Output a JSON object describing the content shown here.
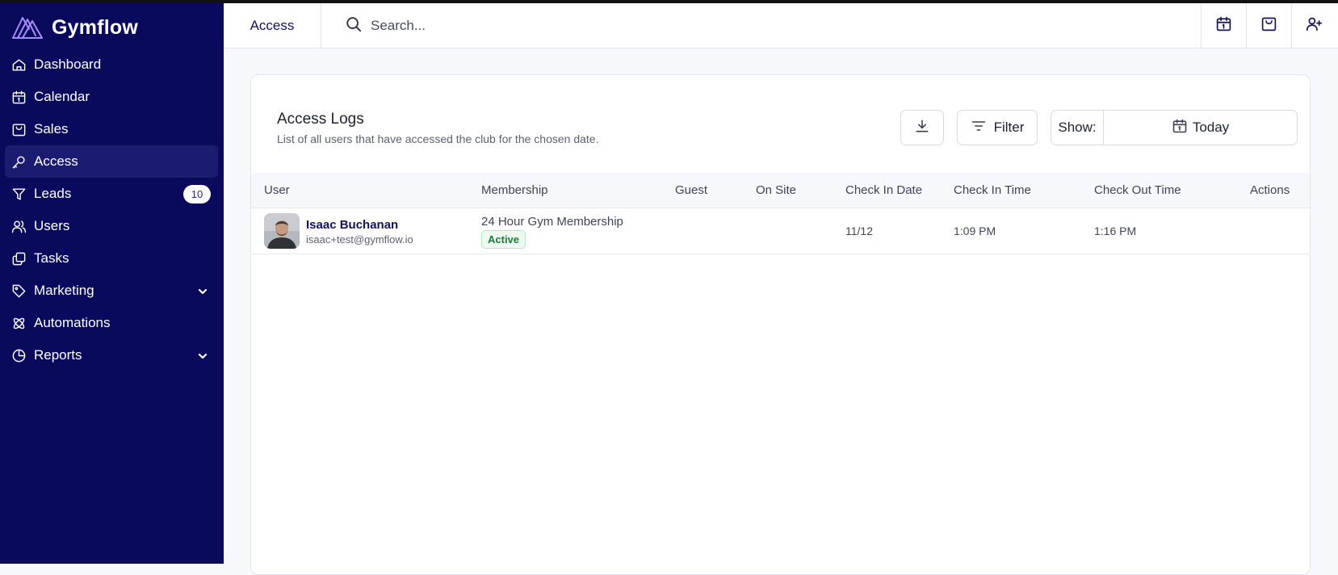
{
  "app": {
    "name": "Gymflow"
  },
  "sidebar": {
    "items": [
      {
        "label": "Dashboard",
        "icon": "home-icon"
      },
      {
        "label": "Calendar",
        "icon": "calendar-icon"
      },
      {
        "label": "Sales",
        "icon": "shopping-bag-icon"
      },
      {
        "label": "Access",
        "icon": "key-icon",
        "active": true
      },
      {
        "label": "Leads",
        "icon": "filter-icon",
        "badge": "10"
      },
      {
        "label": "Users",
        "icon": "users-icon"
      },
      {
        "label": "Tasks",
        "icon": "tasks-icon"
      },
      {
        "label": "Marketing",
        "icon": "tag-icon",
        "expandable": true
      },
      {
        "label": "Automations",
        "icon": "atom-icon"
      },
      {
        "label": "Reports",
        "icon": "pie-chart-icon",
        "expandable": true
      }
    ]
  },
  "header": {
    "title": "Access",
    "search_placeholder": "Search...",
    "actions": [
      "calendar-icon",
      "shopping-bag-icon",
      "user-plus-icon"
    ]
  },
  "card": {
    "title": "Access Logs",
    "subtitle": "List of all users that have accessed the club for the chosen date.",
    "filter_label": "Filter",
    "show_label": "Show:",
    "show_value": "Today"
  },
  "table": {
    "columns": [
      "User",
      "Membership",
      "Guest",
      "On Site",
      "Check In Date",
      "Check In Time",
      "Check Out Time",
      "Actions"
    ],
    "rows": [
      {
        "name": "Isaac Buchanan",
        "email": "isaac+test@gymflow.io",
        "membership": "24 Hour Gym Membership",
        "status": "Active",
        "guest": "",
        "on_site": "",
        "check_in_date": "11/12",
        "check_in_time": "1:09 PM",
        "check_out_time": "1:16 PM"
      }
    ]
  },
  "colors": {
    "sidebar_bg": "#0a0a5c",
    "sidebar_active": "#1b1b6f",
    "brand_accent": "#8b5cf6",
    "status_active": "#1b7a3d"
  }
}
